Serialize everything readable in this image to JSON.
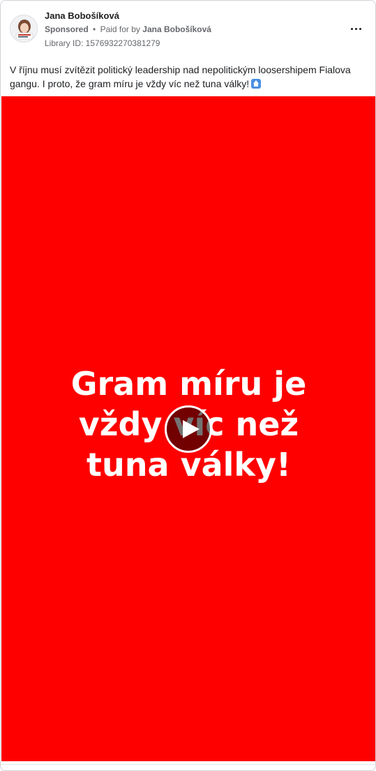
{
  "post": {
    "author": "Jana Bobošíková",
    "sponsored_label": "Sponsored",
    "separator": "•",
    "paid_for_prefix": "Paid for by",
    "paid_for_name": "Jana Bobošíková",
    "library_id": "Library ID: 1576932270381279",
    "caption": "V říjnu musí zvítězit politický leadership nad nepolitickým loosershipem Fialova gangu. I proto, že gram míru je vždy víc než tuna války!",
    "caption_emoji": "up-arrow-emoji"
  },
  "video": {
    "background_color": "#fe0000",
    "text_lines": [
      "Gram míru je",
      "vždy víc než",
      "tuna války!"
    ],
    "play_icon": "play-icon"
  },
  "icons": {
    "more": "more-options-icon",
    "avatar": "avatar"
  }
}
